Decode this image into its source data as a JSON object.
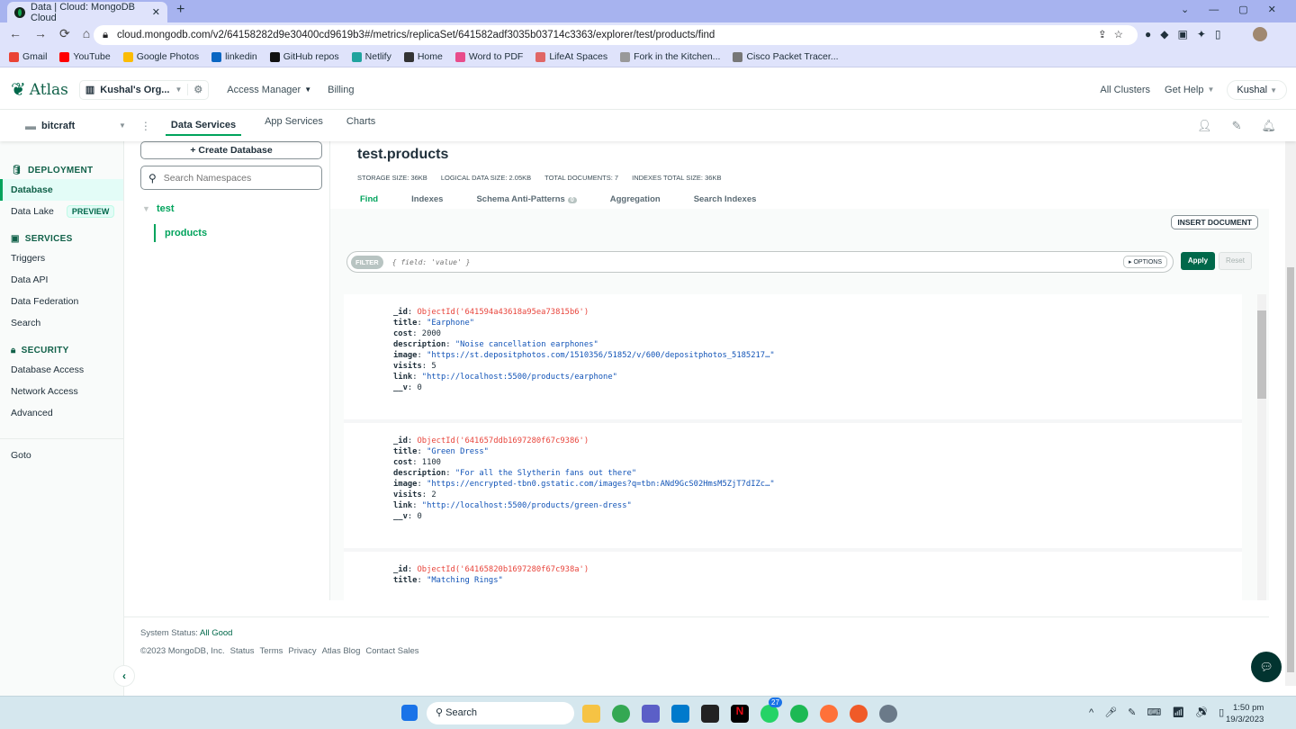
{
  "browser": {
    "tab_title": "Data | Cloud: MongoDB Cloud",
    "new_tab": "+",
    "url": "cloud.mongodb.com/v2/64158282d9e30400cd9619b3#/metrics/replicaSet/641582adf3035b03714c3363/explorer/test/products/find",
    "bookmarks": [
      {
        "label": "Gmail",
        "color": "#ea4335"
      },
      {
        "label": "YouTube",
        "color": "#ff0000"
      },
      {
        "label": "Google Photos",
        "color": "#fbbc04"
      },
      {
        "label": "linkedin",
        "color": "#0a66c2"
      },
      {
        "label": "GitHub repos",
        "color": "#111111"
      },
      {
        "label": "Netlify",
        "color": "#20a39e"
      },
      {
        "label": "Home",
        "color": "#333333"
      },
      {
        "label": "Word to PDF",
        "color": "#e84c8b"
      },
      {
        "label": "LifeAt Spaces",
        "color": "#e06666"
      },
      {
        "label": "Fork in the Kitchen...",
        "color": "#999999"
      },
      {
        "label": "Cisco Packet Tracer...",
        "color": "#777777"
      }
    ]
  },
  "header": {
    "logo": "Atlas",
    "org": "Kushal's Org...",
    "access_manager": "Access Manager",
    "billing": "Billing",
    "all_clusters": "All Clusters",
    "get_help": "Get Help",
    "user": "Kushal"
  },
  "nav": {
    "project": "bitcraft",
    "tabs": [
      "Data Services",
      "App Services",
      "Charts"
    ],
    "active_tab": "Data Services"
  },
  "sidebar": {
    "sections": [
      {
        "title": "DEPLOYMENT",
        "items": [
          {
            "label": "Database",
            "active": true
          },
          {
            "label": "Data Lake",
            "badge": "PREVIEW"
          }
        ]
      },
      {
        "title": "SERVICES",
        "items": [
          {
            "label": "Triggers"
          },
          {
            "label": "Data API"
          },
          {
            "label": "Data Federation"
          },
          {
            "label": "Search"
          }
        ]
      },
      {
        "title": "SECURITY",
        "items": [
          {
            "label": "Database Access"
          },
          {
            "label": "Network Access"
          },
          {
            "label": "Advanced"
          }
        ]
      }
    ],
    "goto": "Goto"
  },
  "namespaces": {
    "create_button": "+ Create Database",
    "search_placeholder": "Search Namespaces",
    "database": "test",
    "collection": "products"
  },
  "collection": {
    "title": "test.products",
    "stats": [
      "STORAGE SIZE: 36KB",
      "LOGICAL DATA SIZE: 2.05KB",
      "TOTAL DOCUMENTS: 7",
      "INDEXES TOTAL SIZE: 36KB"
    ],
    "tabs": [
      "Find",
      "Indexes",
      "Schema Anti-Patterns",
      "Aggregation",
      "Search Indexes"
    ],
    "active_tab": "Find",
    "anti_patterns_count": "0",
    "insert_button": "INSERT DOCUMENT",
    "filter_label": "FILTER",
    "filter_placeholder": "{ field: 'value' }",
    "options_button": "▸ OPTIONS",
    "apply_button": "Apply",
    "reset_button": "Reset"
  },
  "documents": [
    {
      "fields": [
        [
          "_id",
          "ObjectId('641594a43618a95ea73815b6')",
          "oid"
        ],
        [
          "title",
          "\"Earphone\"",
          "s"
        ],
        [
          "cost",
          "2000",
          "n"
        ],
        [
          "description",
          "\"Noise cancellation earphones\"",
          "s"
        ],
        [
          "image",
          "\"https://st.depositphotos.com/1510356/51852/v/600/depositphotos_5185217…\"",
          "s"
        ],
        [
          "visits",
          "5",
          "n"
        ],
        [
          "link",
          "\"http://localhost:5500/products/earphone\"",
          "s"
        ],
        [
          "__v",
          "0",
          "n"
        ]
      ]
    },
    {
      "fields": [
        [
          "_id",
          "ObjectId('641657ddb1697280f67c9386')",
          "oid"
        ],
        [
          "title",
          "\"Green Dress\"",
          "s"
        ],
        [
          "cost",
          "1100",
          "n"
        ],
        [
          "description",
          "\"For all the Slytherin fans out there\"",
          "s"
        ],
        [
          "image",
          "\"https://encrypted-tbn0.gstatic.com/images?q=tbn:ANd9GcS02HmsM5ZjT7dIZc…\"",
          "s"
        ],
        [
          "visits",
          "2",
          "n"
        ],
        [
          "link",
          "\"http://localhost:5500/products/green-dress\"",
          "s"
        ],
        [
          "__v",
          "0",
          "n"
        ]
      ]
    },
    {
      "fields": [
        [
          "_id",
          "ObjectId('64165820b1697280f67c938a')",
          "oid"
        ],
        [
          "title",
          "\"Matching Rings\"",
          "s"
        ]
      ]
    }
  ],
  "footer": {
    "status_label": "System Status:",
    "status_value": "All Good",
    "copyright": "©2023 MongoDB, Inc.",
    "links": [
      "Status",
      "Terms",
      "Privacy",
      "Atlas Blog",
      "Contact Sales"
    ]
  },
  "taskbar": {
    "search": "Search",
    "whatsapp_badge": "27",
    "time": "1:50 pm",
    "date": "19/3/2023"
  },
  "colors": {
    "accent": "#00684a",
    "green": "#00a35c",
    "oid": "#e8453c",
    "string": "#1254b7"
  }
}
